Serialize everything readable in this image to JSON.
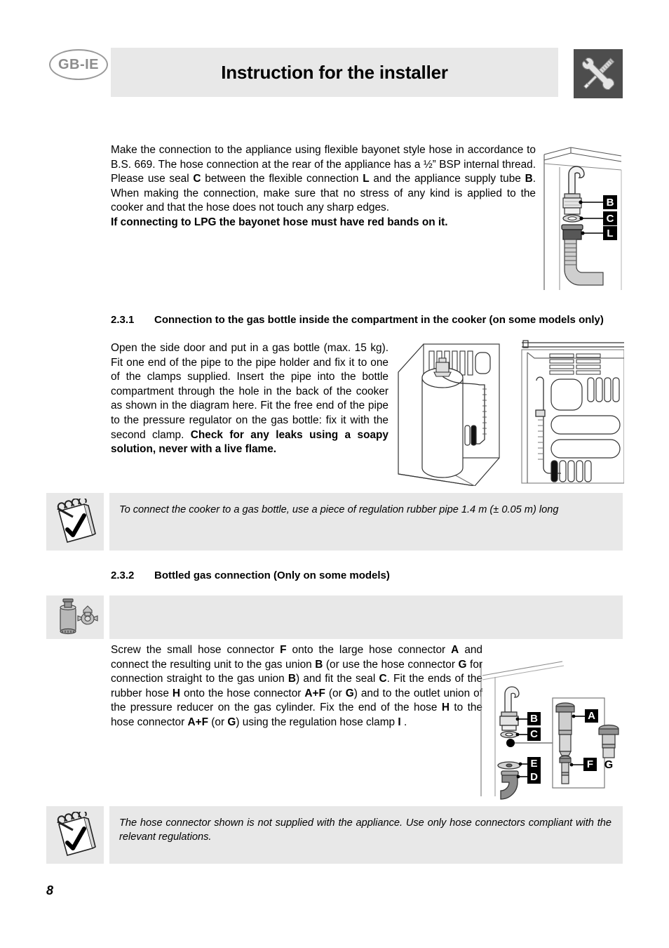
{
  "header": {
    "locale_badge": "GB-IE",
    "title": "Instruction for the installer",
    "tools_icon": "wrench-screwdriver-icon"
  },
  "intro": {
    "text_1": "Make the connection to the appliance using flexible bayonet style hose in accordance to B.S. 669. The hose connection at the rear of the appliance has a ½” BSP internal thread. Please use seal ",
    "bold_c": "C",
    "text_2": " between the flexible connection ",
    "bold_l": "L",
    "text_3": " and the appliance supply tube ",
    "bold_b": "B",
    "text_4": ". When making the connection, make sure that no stress of any kind is applied to the cooker and that the hose does not touch any sharp edges.",
    "warning": "If connecting to LPG the bayonet hose must have red bands on it."
  },
  "section_231": {
    "number": "2.3.1",
    "title": "Connection to the gas bottle inside the compartment in the cooker (on some models only)",
    "body_normal": "Open the side door and put in a gas bottle (max. 15 kg). Fit one end of the pipe to the pipe holder and fix it to one of the clamps supplied. Insert the pipe into the bottle compartment through the hole in the back of the cooker as shown in the diagram here. Fit the free end of the pipe to the pressure regulator on the gas bottle: fix it with the second clamp. ",
    "body_bold": "Check for any leaks using a soapy solution, never with a live flame."
  },
  "note_1": {
    "icon": "notepad-check-icon",
    "text": "To connect the cooker to a gas bottle, use a piece of regulation rubber pipe 1.4 m (± 0.05 m) long"
  },
  "section_232": {
    "number": "2.3.2",
    "title": "Bottled gas connection (Only on some models)",
    "icon": "gas-cylinder-regulator-icon",
    "banner_text": "",
    "body_1": "Screw the small hose connector ",
    "b_f": "F",
    "body_2": " onto the large hose connector ",
    "b_a": "A",
    "body_3": " and connect the resulting unit to the gas union ",
    "b_b1": "B",
    "body_4": " (or use the hose connector ",
    "b_g1": "G",
    "body_5": " for connection straight to the gas union ",
    "b_b2": "B",
    "body_6": ") and fit the seal ",
    "b_c": "C",
    "body_7": ". Fit the ends of the rubber hose ",
    "b_h1": "H",
    "body_8": " onto the hose connector ",
    "b_af1": "A+F",
    "body_9": " (or ",
    "b_g2": "G",
    "body_10": ") and to the outlet union of the pressure reducer on the gas cylinder. Fix the end of the hose ",
    "b_h2": "H",
    "body_11": " to the hose connector ",
    "b_af2": "A+F",
    "body_12": " (or ",
    "b_g3": "G",
    "body_13": ") using the regulation hose clamp ",
    "b_i": "I",
    "body_14": " ."
  },
  "note_2": {
    "icon": "notepad-check-icon",
    "text": "The hose connector      shown is not supplied with the appliance. Use only hose connectors compliant with the relevant regulations."
  },
  "figures": {
    "bayonet_connection": {
      "name": "bayonet-hose-connection-diagram",
      "labels": [
        "B",
        "C",
        "L"
      ]
    },
    "gas_bottle_compartment": {
      "name": "gas-bottle-in-compartment-diagram",
      "labels": []
    },
    "cooker_rear_panel": {
      "name": "cooker-rear-panel-pipe-diagram",
      "labels": []
    },
    "hose_connectors": {
      "name": "hose-connector-parts-diagram",
      "labels": [
        "B",
        "C",
        "E",
        "D",
        "A",
        "F",
        "G"
      ]
    }
  },
  "footer": {
    "page_number": "8"
  },
  "colors": {
    "panel_gray": "#e8e8e8",
    "icon_box_dark": "#4d4d4d",
    "badge_gray": "#8c8c8c",
    "line_art": "#333333"
  }
}
